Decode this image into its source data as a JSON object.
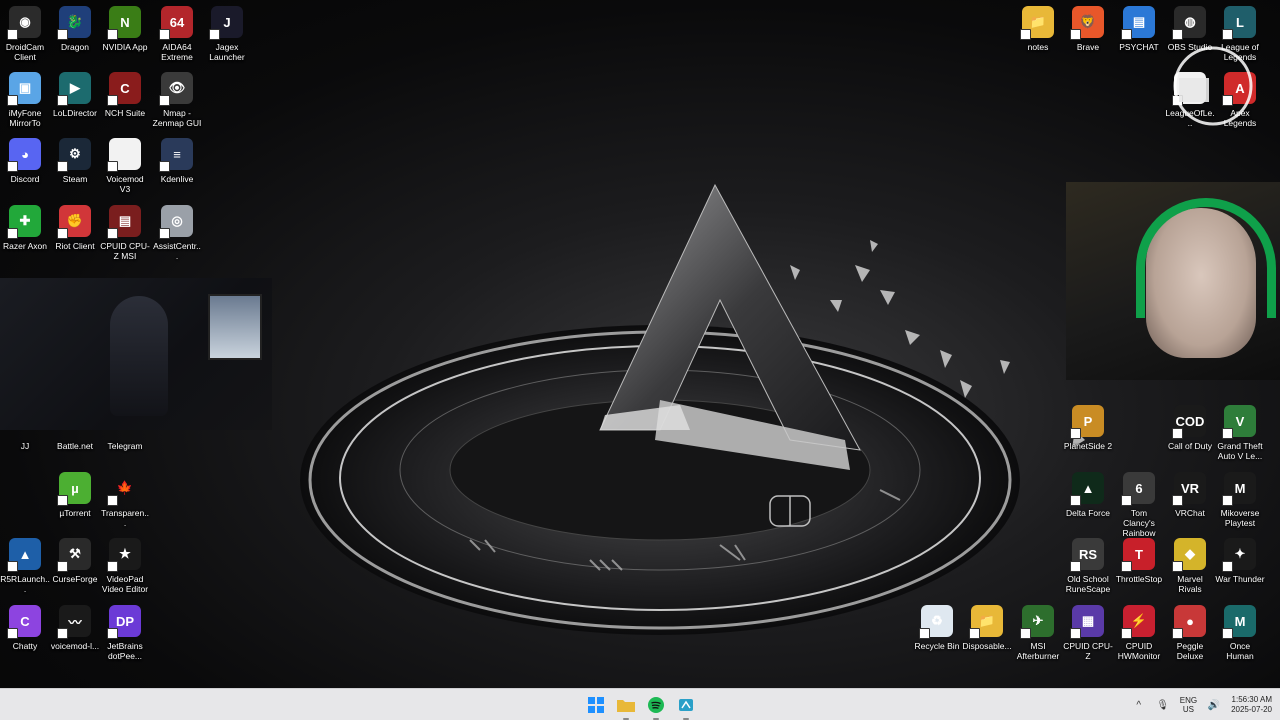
{
  "desktop": {
    "icons": [
      {
        "label": "DroidCam Client",
        "icon": "droidcam-icon",
        "color": "#2b2b2b",
        "glyph": "◉"
      },
      {
        "label": "Dragon",
        "icon": "dragon-icon",
        "color": "#1f3f7a",
        "glyph": "🐉"
      },
      {
        "label": "NVIDIA App",
        "icon": "nvidia-icon",
        "color": "#3a7d16",
        "glyph": "N"
      },
      {
        "label": "AIDA64 Extreme",
        "icon": "aida64-icon",
        "color": "#b3262b",
        "glyph": "64"
      },
      {
        "label": "Jagex Launcher",
        "icon": "jagex-icon",
        "color": "#1a1a2a",
        "glyph": "J"
      },
      {
        "label": "iMyFone MirrorTo",
        "icon": "imyfone-icon",
        "color": "#5aa5e6",
        "glyph": "▣"
      },
      {
        "label": "LoLDirector",
        "icon": "loldirector-icon",
        "color": "#1c6b6e",
        "glyph": "▶"
      },
      {
        "label": "NCH Suite",
        "icon": "nch-icon",
        "color": "#8a1c1c",
        "glyph": "C"
      },
      {
        "label": "Nmap - Zenmap GUI",
        "icon": "nmap-icon",
        "color": "#3a3a3a",
        "glyph": "👁"
      },
      {
        "label": "Discord",
        "icon": "discord-icon",
        "color": "#5865f2",
        "glyph": "◕"
      },
      {
        "label": "Steam",
        "icon": "steam-icon",
        "color": "#1b2838",
        "glyph": "⚙"
      },
      {
        "label": "Voicemod V3",
        "icon": "file-icon",
        "color": "#f2f2f2",
        "glyph": ""
      },
      {
        "label": "Kdenlive",
        "icon": "kdenlive-icon",
        "color": "#2a3a5a",
        "glyph": "≡"
      },
      {
        "label": "Razer Axon",
        "icon": "razer-axon-icon",
        "color": "#22a83a",
        "glyph": "✚"
      },
      {
        "label": "Riot Client",
        "icon": "riot-icon",
        "color": "#d13639",
        "glyph": "✊"
      },
      {
        "label": "CPUID CPU-Z MSI",
        "icon": "cpuz-msi-icon",
        "color": "#7a1e1e",
        "glyph": "▤"
      },
      {
        "label": "AssistCentr...",
        "icon": "assistcentr-icon",
        "color": "#9aa0a8",
        "glyph": "◎"
      },
      {
        "label": "JJ",
        "icon": "",
        "color": "transparent",
        "glyph": ""
      },
      {
        "label": "Battle.net",
        "icon": "",
        "color": "transparent",
        "glyph": ""
      },
      {
        "label": "Telegram",
        "icon": "",
        "color": "transparent",
        "glyph": ""
      },
      {
        "label": "µTorrent",
        "icon": "utorrent-icon",
        "color": "#4caf32",
        "glyph": "µ"
      },
      {
        "label": "Transparen...",
        "icon": "maple-leaf-icon",
        "color": "transparent",
        "glyph": "🍁"
      },
      {
        "label": "R5RLaunch...",
        "icon": "r5r-icon",
        "color": "#1e5fa8",
        "glyph": "▲"
      },
      {
        "label": "CurseForge",
        "icon": "curseforge-icon",
        "color": "#2a2a2a",
        "glyph": "⚒"
      },
      {
        "label": "VideoPad Video Editor",
        "icon": "videopad-icon",
        "color": "#1a1a1a",
        "glyph": "★"
      },
      {
        "label": "Chatty",
        "icon": "chatty-icon",
        "color": "#8d44e0",
        "glyph": "C"
      },
      {
        "label": "voicemod-l...",
        "icon": "voicemod-icon",
        "color": "#1a1a1a",
        "glyph": "〰"
      },
      {
        "label": "JetBrains dotPee...",
        "icon": "dotpeek-icon",
        "color": "#6b3ad6",
        "glyph": "DP"
      },
      {
        "label": "notes",
        "icon": "folder-icon",
        "color": "#e8b838",
        "glyph": "📁"
      },
      {
        "label": "Brave",
        "icon": "brave-icon",
        "color": "#e8572a",
        "glyph": "🦁"
      },
      {
        "label": "PSYCHAT",
        "icon": "document-icon",
        "color": "#2b78d6",
        "glyph": "▤"
      },
      {
        "label": "OBS Studio",
        "icon": "obs-icon",
        "color": "#2a2a2a",
        "glyph": "◍"
      },
      {
        "label": "League of Legends",
        "icon": "league-icon",
        "color": "#1f5e6a",
        "glyph": "L"
      },
      {
        "label": "LeagueOfLe...",
        "icon": "file-icon",
        "color": "#f2f2f2",
        "glyph": ""
      },
      {
        "label": "Apex Legends",
        "icon": "apex-icon",
        "color": "#d02a2a",
        "glyph": "A"
      },
      {
        "label": "PlanetSide 2",
        "icon": "planetside-icon",
        "color": "#c98c24",
        "glyph": "P"
      },
      {
        "label": "Call of Duty",
        "icon": "cod-icon",
        "color": "#1a1a1a",
        "glyph": "COD"
      },
      {
        "label": "Grand Theft Auto V Le...",
        "icon": "gta-icon",
        "color": "#2e7d3a",
        "glyph": "V"
      },
      {
        "label": "Delta Force",
        "icon": "delta-force-icon",
        "color": "#0f2a1a",
        "glyph": "▲"
      },
      {
        "label": "Tom Clancy's Rainbow Si...",
        "icon": "rainbow-six-icon",
        "color": "#3a3a3a",
        "glyph": "6"
      },
      {
        "label": "VRChat",
        "icon": "vrchat-icon",
        "color": "#1a1a1a",
        "glyph": "VR"
      },
      {
        "label": "Mikoverse Playtest",
        "icon": "mikoverse-icon",
        "color": "#1a1a1a",
        "glyph": "M"
      },
      {
        "label": "Old School RuneScape",
        "icon": "osrs-icon",
        "color": "#3a3a3a",
        "glyph": "RS"
      },
      {
        "label": "ThrottleStop",
        "icon": "throttlestop-icon",
        "color": "#c8202a",
        "glyph": "T"
      },
      {
        "label": "Marvel Rivals",
        "icon": "marvel-rivals-icon",
        "color": "#d4b42a",
        "glyph": "◆"
      },
      {
        "label": "War Thunder",
        "icon": "war-thunder-icon",
        "color": "#1a1a1a",
        "glyph": "✦"
      },
      {
        "label": "Recycle Bin",
        "icon": "recycle-bin-icon",
        "color": "#dfe8f0",
        "glyph": "♻"
      },
      {
        "label": "Disposable...",
        "icon": "folder-icon",
        "color": "#e8b838",
        "glyph": "📁"
      },
      {
        "label": "MSI Afterburner",
        "icon": "afterburner-icon",
        "color": "#2d6e2d",
        "glyph": "✈"
      },
      {
        "label": "CPUID CPU-Z",
        "icon": "cpuz-icon",
        "color": "#5a3aa8",
        "glyph": "▦"
      },
      {
        "label": "CPUID HWMonitor",
        "icon": "hwmonitor-icon",
        "color": "#c82030",
        "glyph": "⚡"
      },
      {
        "label": "Peggle Deluxe",
        "icon": "peggle-icon",
        "color": "#c83838",
        "glyph": "●"
      },
      {
        "label": "Once Human",
        "icon": "once-human-icon",
        "color": "#1a6a6a",
        "glyph": "M"
      }
    ]
  },
  "taskbar": {
    "apps": [
      {
        "name": "start-button",
        "icon": "windows-icon",
        "color": "#1e90ff"
      },
      {
        "name": "file-explorer-button",
        "icon": "folder-icon",
        "color": "#e8b838"
      },
      {
        "name": "spotify-button",
        "icon": "spotify-icon",
        "color": "#1db954"
      },
      {
        "name": "app-button",
        "icon": "app-icon",
        "color": "#2aa0c8"
      }
    ],
    "tray": {
      "lang_top": "ENG",
      "lang_bottom": "US",
      "time": "1:56:30 AM",
      "date": "2025-07-20",
      "chevron": "^",
      "mic": "🎙",
      "volume": "🔊"
    }
  }
}
